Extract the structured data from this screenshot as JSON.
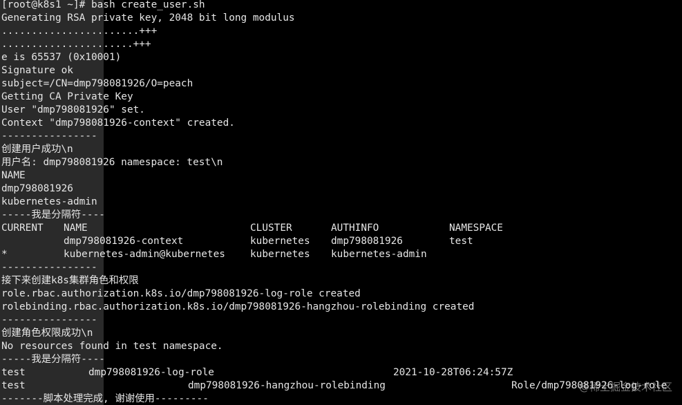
{
  "terminal": {
    "lines_top": [
      "[root@k8s1 ~]# bash create_user.sh",
      "Generating RSA private key, 2048 bit long modulus",
      ".......................+++",
      "......................+++",
      "e is 65537 (0x10001)",
      "Signature ok",
      "subject=/CN=dmp798081926/O=peach",
      "Getting CA Private Key",
      "User \"dmp798081926\" set.",
      "Context \"dmp798081926-context\" created.",
      "----------------",
      "创建用户成功\\n",
      "用户名: dmp798081926 namespace: test\\n",
      "NAME",
      "dmp798081926",
      "kubernetes-admin",
      "-----我是分隔符----"
    ],
    "contexts_table": {
      "headers": [
        "CURRENT",
        "NAME",
        "CLUSTER",
        "AUTHINFO",
        "NAMESPACE"
      ],
      "rows": [
        [
          "",
          "dmp798081926-context",
          "kubernetes",
          "dmp798081926",
          "test"
        ],
        [
          "*",
          "kubernetes-admin@kubernetes",
          "kubernetes",
          "kubernetes-admin",
          ""
        ]
      ]
    },
    "lines_middle": [
      "----------------",
      "接下来创建k8s集群角色和权限",
      "role.rbac.authorization.k8s.io/dmp798081926-log-role created",
      "rolebinding.rbac.authorization.k8s.io/dmp798081926-hangzhou-rolebinding created",
      "----------------",
      "创建角色权限成功\\n",
      "No resources found in test namespace.",
      "-----我是分隔符----"
    ],
    "role_rows": [
      [
        "test",
        "dmp798081926-log-role",
        "2021-10-28T06:24:57Z"
      ],
      [
        "test",
        "dmp798081926-hangzhou-rolebinding",
        "Role/dmp798081926-log-role"
      ]
    ],
    "last_line": "-------脚本处理完成, 谢谢使用---------",
    "watermark": "@稀土掘金技术社区"
  }
}
